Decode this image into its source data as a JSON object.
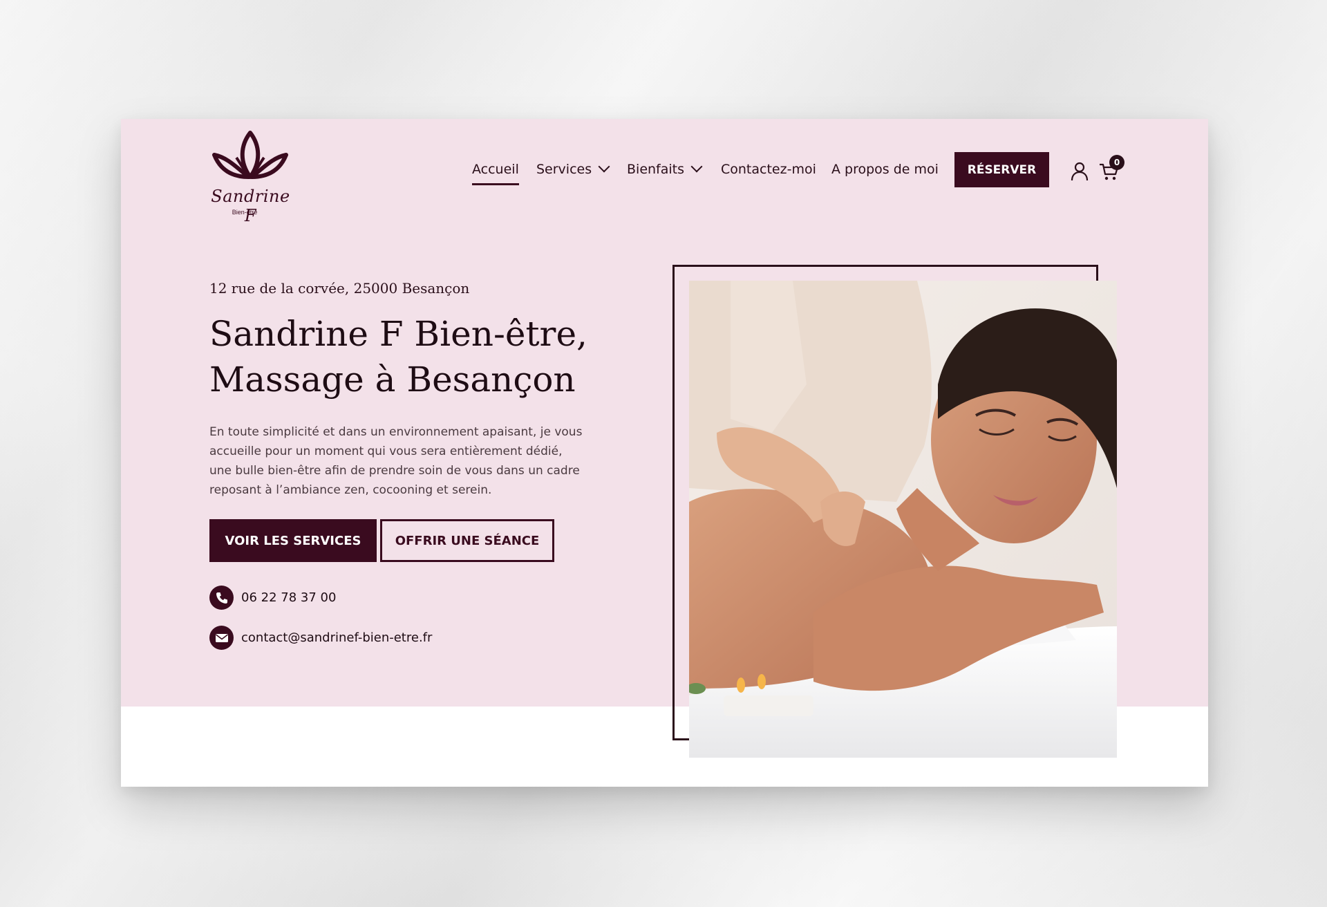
{
  "brand": {
    "logo_name": "Sandrine F",
    "logo_tagline": "Bien-être",
    "logo_icon": "lotus-icon",
    "primary_color": "#3a0b1f",
    "hero_bg_color": "#f3e1e9"
  },
  "nav": {
    "items": [
      {
        "label": "Accueil",
        "active": true
      },
      {
        "label": "Services",
        "dropdown": true
      },
      {
        "label": "Bienfaits",
        "dropdown": true
      },
      {
        "label": "Contactez-moi"
      },
      {
        "label": "A propos de moi"
      }
    ],
    "cta_label": "RÉSERVER",
    "user_icon": "user-icon",
    "cart_icon": "cart-icon",
    "cart_count": "0"
  },
  "hero": {
    "address": "12 rue de la corvée, 25000 Besançon",
    "title_line1": "Sandrine F Bien-être,",
    "title_line2": "Massage à Besançon",
    "description": "En toute simplicité et dans un environnement apaisant, je vous accueille pour un moment qui vous sera entièrement dédié, une bulle bien-être afin de prendre soin de vous dans un cadre reposant à l’ambiance zen, cocooning et serein.",
    "primary_button": "VOIR LES SERVICES",
    "secondary_button": "OFFRIR UNE SÉANCE",
    "phone": "06 22 78 37 00",
    "email": "contact@sandrinef-bien-etre.fr",
    "phone_icon": "phone-icon",
    "email_icon": "mail-icon"
  }
}
